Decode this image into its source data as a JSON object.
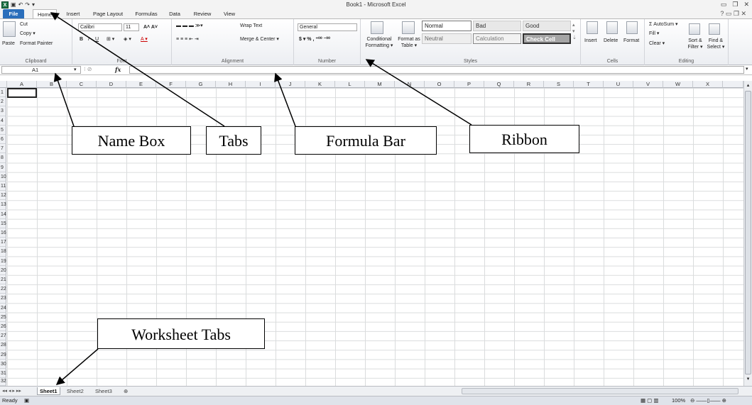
{
  "window": {
    "title": "Book1 - Microsoft Excel"
  },
  "tabs": [
    "File",
    "Home",
    "Insert",
    "Page Layout",
    "Formulas",
    "Data",
    "Review",
    "View"
  ],
  "ribbon": {
    "clipboard": {
      "paste": "Paste",
      "cut": "Cut",
      "copy": "Copy ▾",
      "format_painter": "Format Painter",
      "label": "Clipboard"
    },
    "font": {
      "name": "Calibri",
      "size": "11",
      "label": "Font"
    },
    "alignment": {
      "wrap": "Wrap Text",
      "merge": "Merge & Center ▾",
      "label": "Alignment"
    },
    "number": {
      "format": "General",
      "label": "Number"
    },
    "styles": {
      "cond": "Conditional Formatting ▾",
      "fmt_table": "Format as Table ▾",
      "normal": "Normal",
      "bad": "Bad",
      "good": "Good",
      "neutral": "Neutral",
      "calculation": "Calculation",
      "check": "Check Cell",
      "label": "Styles"
    },
    "cells": {
      "insert": "Insert",
      "delete": "Delete",
      "format": "Format",
      "label": "Cells"
    },
    "editing": {
      "autosum": "Σ AutoSum ▾",
      "fill": "Fill ▾",
      "clear": "Clear ▾",
      "sort": "Sort & Filter ▾",
      "find": "Find & Select ▾",
      "label": "Editing"
    }
  },
  "formula_bar": {
    "name_box": "A1",
    "fx": "fx",
    "value": ""
  },
  "columns": [
    "A",
    "B",
    "C",
    "D",
    "E",
    "F",
    "G",
    "H",
    "I",
    "J",
    "K",
    "L",
    "M",
    "N",
    "O",
    "P",
    "Q",
    "R",
    "S",
    "T",
    "U",
    "V",
    "W",
    "X"
  ],
  "rows": [
    "1",
    "2",
    "3",
    "4",
    "5",
    "6",
    "7",
    "8",
    "9",
    "10",
    "11",
    "12",
    "13",
    "14",
    "15",
    "16",
    "17",
    "18",
    "19",
    "20",
    "21",
    "22",
    "23",
    "24",
    "25",
    "26",
    "27",
    "28",
    "29",
    "30",
    "31",
    "32"
  ],
  "sheets": [
    "Sheet1",
    "Sheet2",
    "Sheet3"
  ],
  "status": {
    "ready": "Ready",
    "zoom": "100%"
  },
  "annotations": {
    "name_box": "Name Box",
    "tabs": "Tabs",
    "formula_bar": "Formula Bar",
    "ribbon": "Ribbon",
    "worksheet_tabs": "Worksheet Tabs"
  }
}
